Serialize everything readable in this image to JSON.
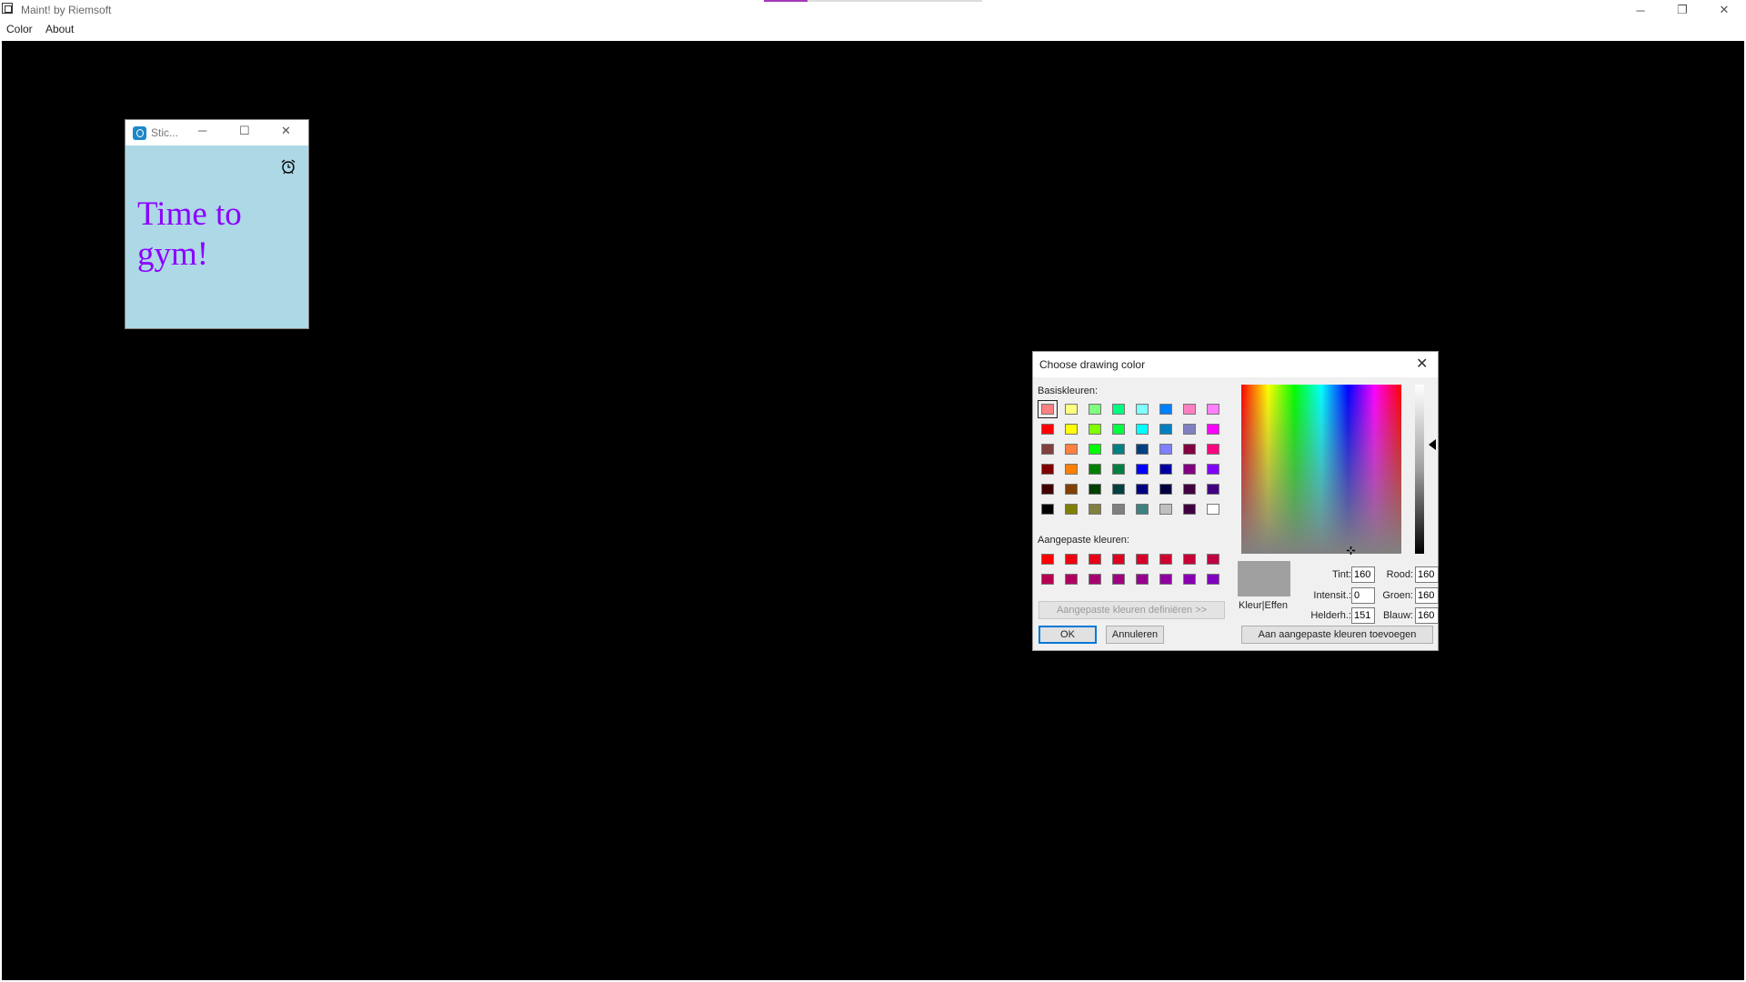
{
  "app": {
    "title": "Maint! by Riemsoft",
    "progress_fraction": 0.2,
    "progress_color": "#a33ab8",
    "window_buttons": {
      "minimize": "─",
      "restore": "❐",
      "close": "✕"
    }
  },
  "menu": {
    "items": [
      "Color",
      "About"
    ]
  },
  "canvas": {
    "background": "#000000"
  },
  "sticky": {
    "title": "Stic...",
    "text_line1": "Time to",
    "text_line2": "gym!",
    "background": "#add8e6",
    "text_color": "#8b00ff",
    "buttons": {
      "minimize": "─",
      "maximize": "☐",
      "close": "✕"
    },
    "icon": "alarm-clock-icon"
  },
  "dialog": {
    "title": "Choose drawing color",
    "close": "✕",
    "basic_label": "Basiskleuren:",
    "basic_colors": [
      [
        "#ff8080",
        "#ffff80",
        "#80ff80",
        "#00ff80",
        "#80ffff",
        "#0080ff",
        "#ff80c0",
        "#ff80ff"
      ],
      [
        "#ff0000",
        "#ffff00",
        "#80ff00",
        "#00ff40",
        "#00ffff",
        "#0080c0",
        "#8080c0",
        "#ff00ff"
      ],
      [
        "#804040",
        "#ff8040",
        "#00ff00",
        "#008080",
        "#004080",
        "#8080ff",
        "#800040",
        "#ff0080"
      ],
      [
        "#800000",
        "#ff8000",
        "#008000",
        "#008040",
        "#0000ff",
        "#0000a0",
        "#800080",
        "#8000ff"
      ],
      [
        "#400000",
        "#804000",
        "#004000",
        "#004040",
        "#000080",
        "#000040",
        "#400040",
        "#400080"
      ],
      [
        "#000000",
        "#808000",
        "#808040",
        "#808080",
        "#408080",
        "#c0c0c0",
        "#400040",
        "#ffffff"
      ]
    ],
    "custom_label": "Aangepaste kleuren:",
    "custom_colors": [
      [
        "#ff0000",
        "#f00010",
        "#e80018",
        "#e00020",
        "#d80028",
        "#d00030",
        "#c80038",
        "#c00040"
      ],
      [
        "#b80050",
        "#b00060",
        "#a80070",
        "#a00080",
        "#980090",
        "#9000a0",
        "#8800b0",
        "#8000c0"
      ]
    ],
    "define_button": "Aangepaste kleuren definiëren >>",
    "ok_button": "OK",
    "cancel_button": "Annuleren",
    "add_button": "Aan aangepaste kleuren toevoegen",
    "solid_label": "Kleur|Effen",
    "fields": {
      "tint_label": "Tint:",
      "tint": "160",
      "sat_label": "Intensit.:",
      "sat": "0",
      "lum_label": "Helderh.:",
      "lum": "151",
      "red_label": "Rood:",
      "red": "160",
      "green_label": "Groen:",
      "green": "160",
      "blue_label": "Blauw:",
      "blue": "160"
    },
    "preview_color": "#a0a0a0"
  }
}
